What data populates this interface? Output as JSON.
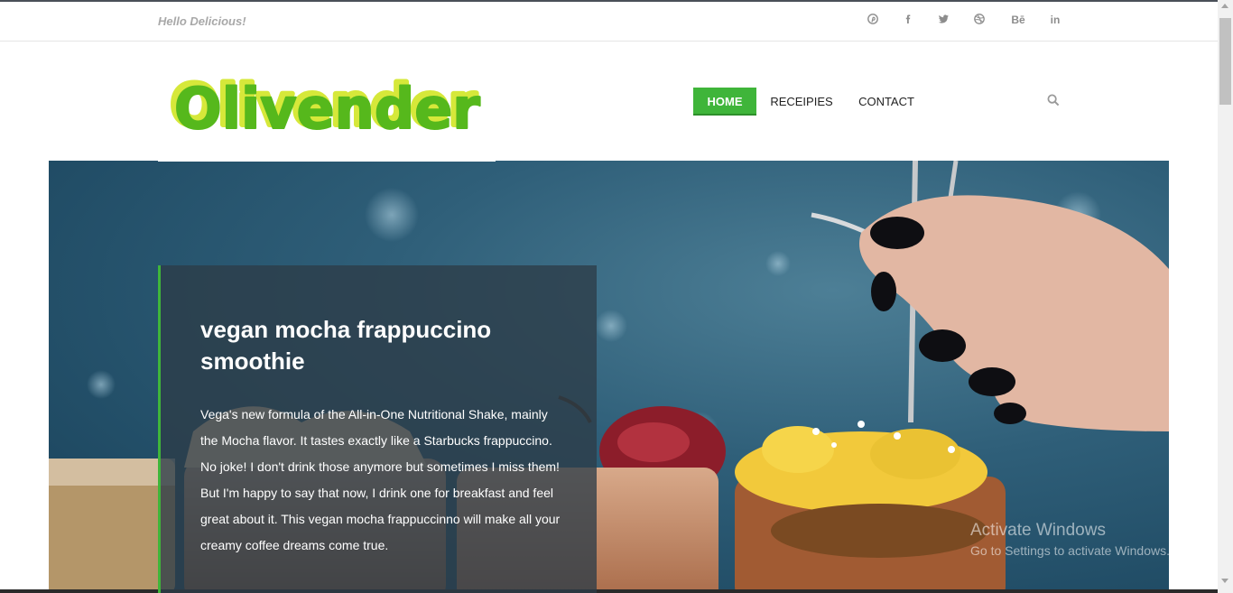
{
  "topbar": {
    "tagline": "Hello Delicious!",
    "social": [
      {
        "icon": "pinterest-icon",
        "glyph": "℗"
      },
      {
        "icon": "facebook-icon",
        "glyph": "f"
      },
      {
        "icon": "twitter-icon",
        "glyph": "✦"
      },
      {
        "icon": "dribbble-icon",
        "glyph": "◎"
      },
      {
        "icon": "behance-icon",
        "glyph": "Bē"
      },
      {
        "icon": "linkedin-icon",
        "glyph": "in"
      }
    ]
  },
  "brand": {
    "name": "Olivender",
    "color_main": "#5cbf1f",
    "color_shadow": "#c8e03a"
  },
  "nav": {
    "home": "HOME",
    "recipes": "RECEIPIES",
    "contact": "CONTACT",
    "search_icon": "search-icon",
    "accent": "#3fb53a"
  },
  "hero": {
    "title": "vegan mocha frappuccino smoothie",
    "text": "Vega's new formula of the All-in-One Nutritional Shake, mainly the Mocha flavor. It tastes exactly like a Starbucks frappuccino. No joke! I don't drink those anymore but sometimes I miss them! But I'm happy to say that now, I drink one for breakfast and feel great about it. This vegan mocha frappuccinno will make all your creamy coffee dreams come true."
  },
  "watermark": {
    "line1": "Activate Windows",
    "line2": "Go to Settings to activate Windows."
  }
}
